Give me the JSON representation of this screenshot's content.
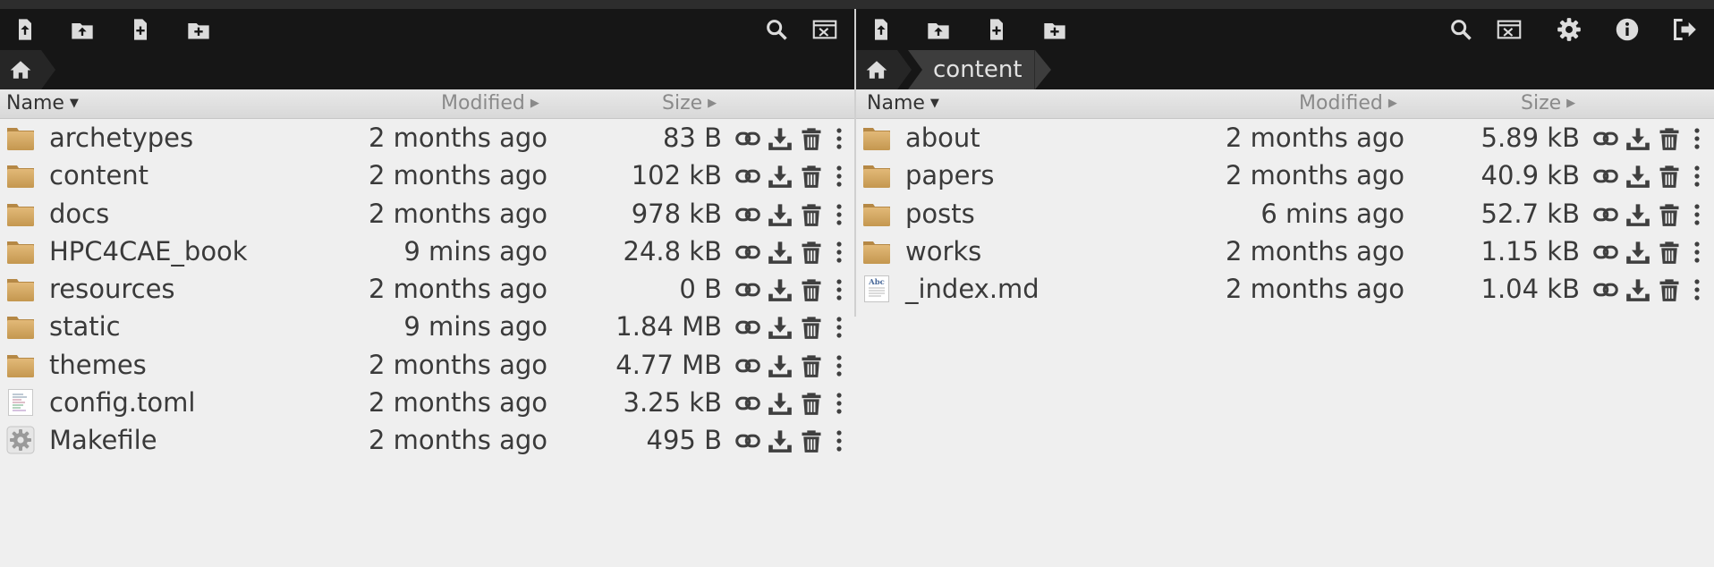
{
  "colors": {
    "toolbar_bg": "#161616",
    "icon_fg": "#dcdcdc",
    "list_bg": "#efefef",
    "folder": "#d4a760",
    "action_icon": "#3f3f3f"
  },
  "left_pane": {
    "toolbar": [
      "upload-file-icon",
      "upload-folder-icon",
      "new-file-icon",
      "new-folder-icon",
      "search-icon",
      "terminal-icon"
    ],
    "breadcrumb": {
      "home_icon": "home-icon",
      "segments": []
    },
    "columns": {
      "name": "Name",
      "modified": "Modified",
      "size": "Size"
    },
    "files": [
      {
        "name": "archetypes",
        "type": "folder",
        "modified": "2 months ago",
        "size": "83 B"
      },
      {
        "name": "content",
        "type": "folder",
        "modified": "2 months ago",
        "size": "102 kB"
      },
      {
        "name": "docs",
        "type": "folder",
        "modified": "2 months ago",
        "size": "978 kB"
      },
      {
        "name": "HPC4CAE_book",
        "type": "folder",
        "modified": "9 mins ago",
        "size": "24.8 kB"
      },
      {
        "name": "resources",
        "type": "folder",
        "modified": "2 months ago",
        "size": "0 B"
      },
      {
        "name": "static",
        "type": "folder",
        "modified": "9 mins ago",
        "size": "1.84 MB"
      },
      {
        "name": "themes",
        "type": "folder",
        "modified": "2 months ago",
        "size": "4.77 MB"
      },
      {
        "name": "config.toml",
        "type": "text",
        "modified": "2 months ago",
        "size": "3.25 kB"
      },
      {
        "name": "Makefile",
        "type": "settings",
        "modified": "2 months ago",
        "size": "495 B"
      }
    ]
  },
  "right_pane": {
    "toolbar": [
      "upload-file-icon",
      "upload-folder-icon",
      "new-file-icon",
      "new-folder-icon",
      "search-icon",
      "terminal-icon",
      "settings-icon",
      "info-icon",
      "logout-icon"
    ],
    "breadcrumb": {
      "home_icon": "home-icon",
      "segments": [
        "content"
      ]
    },
    "columns": {
      "name": "Name",
      "modified": "Modified",
      "size": "Size"
    },
    "files": [
      {
        "name": "about",
        "type": "folder",
        "modified": "2 months ago",
        "size": "5.89 kB"
      },
      {
        "name": "papers",
        "type": "folder",
        "modified": "2 months ago",
        "size": "40.9 kB"
      },
      {
        "name": "posts",
        "type": "folder",
        "modified": "6 mins ago",
        "size": "52.7 kB"
      },
      {
        "name": "works",
        "type": "folder",
        "modified": "2 months ago",
        "size": "1.15 kB"
      },
      {
        "name": "_index.md",
        "type": "document",
        "modified": "2 months ago",
        "size": "1.04 kB"
      }
    ]
  },
  "row_actions": [
    "link-icon",
    "download-icon",
    "trash-icon",
    "more-vertical-icon"
  ],
  "document_icon_label": "Abc"
}
